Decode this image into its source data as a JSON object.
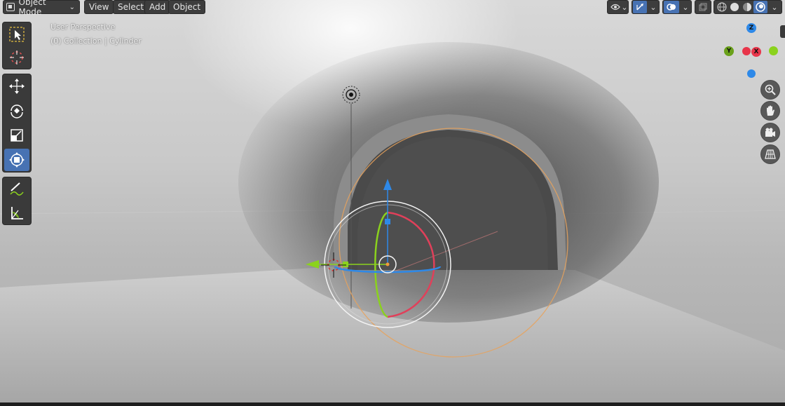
{
  "header": {
    "mode_label": "Object Mode",
    "menus": [
      "View",
      "Select",
      "Add",
      "Object"
    ],
    "overlay_chevron": "⌄"
  },
  "viewport": {
    "perspective_label": "User Perspective",
    "context_label": "(0) Collection | Cylinder"
  },
  "gizmo": {
    "z_label": "Z",
    "y_label": "Y",
    "x_label": "X",
    "x_color": "#e8354a",
    "y_color": "#8bd21d",
    "z_color": "#2e89e8"
  },
  "toolbar": {
    "tools": [
      "select-box",
      "cursor",
      "move",
      "rotate",
      "scale",
      "transform",
      "annotate",
      "measure"
    ],
    "active_tool": "transform"
  },
  "colors": {
    "accent": "#4772b3",
    "header_bg": "#3d3d3d",
    "selection_outline": "#e8a25c"
  }
}
